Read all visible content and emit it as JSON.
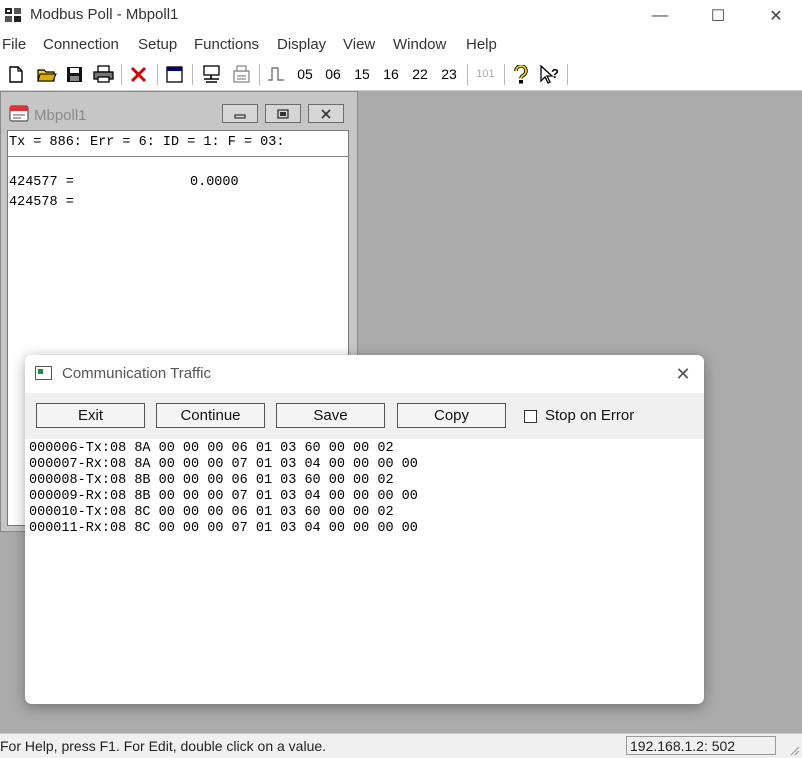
{
  "app": {
    "title": "Modbus Poll - Mbpoll1"
  },
  "window_controls": {
    "minimize": "—",
    "maximize": "☐",
    "close": "✕"
  },
  "menu": [
    "File",
    "Connection",
    "Setup",
    "Functions",
    "Display",
    "View",
    "Window",
    "Help"
  ],
  "toolbar": {
    "func_codes": [
      "05",
      "06",
      "15",
      "16",
      "22",
      "23"
    ],
    "small_label": "101",
    "icons": [
      "new-icon",
      "open-icon",
      "save-icon",
      "print-icon",
      "delete-icon",
      "window-icon",
      "connect-icon",
      "disconnect-icon",
      "pulse-icon",
      "help-icon",
      "context-help-icon"
    ]
  },
  "child_window": {
    "title": "Mbpoll1",
    "status_line": "Tx = 886: Err = 6: ID = 1: F = 03:",
    "rows": [
      {
        "address": "424577 =",
        "value": "0.0000"
      },
      {
        "address": "424578 =",
        "value": ""
      }
    ]
  },
  "dialog": {
    "title": "Communication Traffic",
    "buttons": {
      "exit": "Exit",
      "continue": "Continue",
      "save": "Save",
      "copy": "Copy"
    },
    "stop_on_error": {
      "label": "Stop on Error",
      "checked": false
    },
    "traffic_lines": [
      "000006-Tx:08 8A 00 00 00 06 01 03 60 00 00 02",
      "000007-Rx:08 8A 00 00 00 07 01 03 04 00 00 00 00",
      "000008-Tx:08 8B 00 00 00 06 01 03 60 00 00 02",
      "000009-Rx:08 8B 00 00 00 07 01 03 04 00 00 00 00",
      "000010-Tx:08 8C 00 00 00 06 01 03 60 00 00 02",
      "000011-Rx:08 8C 00 00 00 07 01 03 04 00 00 00 00"
    ]
  },
  "statusbar": {
    "help_text": "For Help, press F1.  For Edit, double click on a value.",
    "connection": "192.168.1.2: 502"
  }
}
